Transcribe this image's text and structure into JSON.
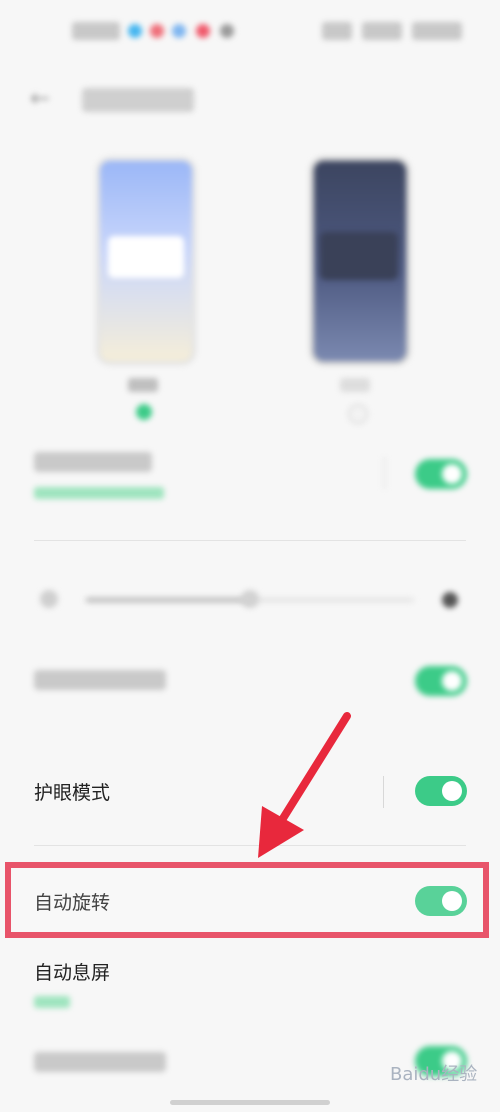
{
  "rows": {
    "eye_care": {
      "label": "护眼模式",
      "enabled": true
    },
    "auto_rotate": {
      "label": "自动旋转",
      "enabled": true
    },
    "auto_screen_off": {
      "label": "自动息屏"
    }
  },
  "brightness": {
    "level_fraction": 0.5
  },
  "annotation": {
    "highlighted_row": "auto_rotate",
    "arrow_color": "#e8283c",
    "box_color": "#e8546a"
  },
  "watermark": {
    "text": "Baidu经验"
  },
  "colors": {
    "accent": "#3ccb88",
    "background": "#f7f7f7"
  }
}
